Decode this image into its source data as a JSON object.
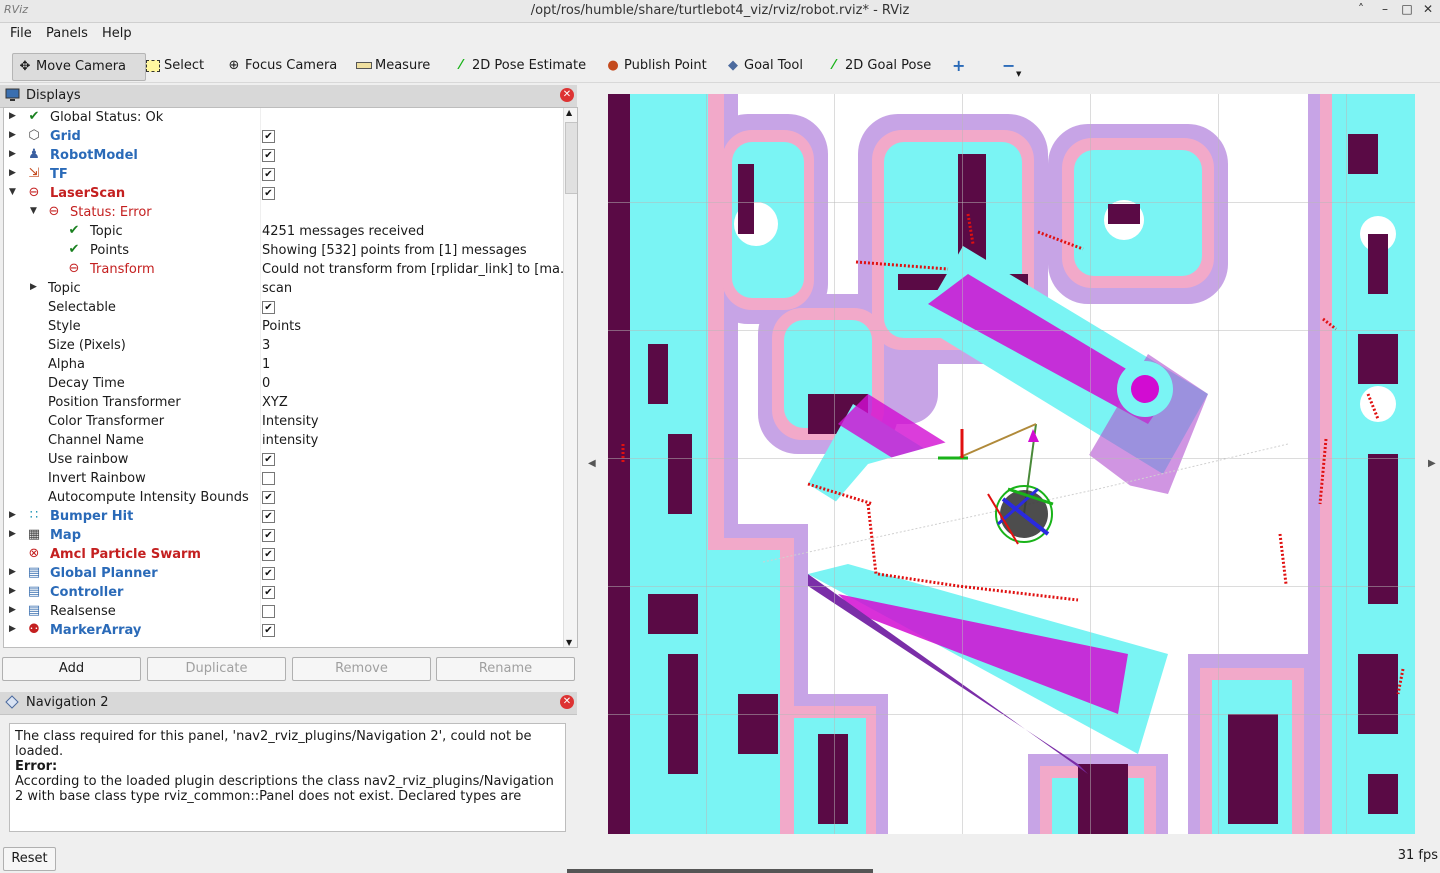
{
  "window": {
    "title": "/opt/ros/humble/share/turtlebot4_viz/rviz/robot.rviz* - RViz",
    "app_icon": "RViz",
    "buttons": [
      "˄",
      "–",
      "□",
      "✕"
    ]
  },
  "menu": {
    "file": "File",
    "panels": "Panels",
    "help": "Help"
  },
  "toolbar": {
    "move_camera": "Move Camera",
    "select": "Select",
    "focus_camera": "Focus Camera",
    "measure": "Measure",
    "pose_estimate": "2D Pose Estimate",
    "publish_point": "Publish Point",
    "goal_tool": "Goal Tool",
    "goal_pose": "2D Goal Pose",
    "add_icon": "+",
    "remove_icon": "−"
  },
  "displays": {
    "title": "Displays",
    "rows": [
      {
        "name": "Global Status: Ok"
      },
      {
        "name": "Grid"
      },
      {
        "name": "RobotModel"
      },
      {
        "name": "TF"
      },
      {
        "name": "LaserScan"
      },
      {
        "name": "Status: Error"
      },
      {
        "name": "Topic",
        "value": "4251 messages received"
      },
      {
        "name": "Points",
        "value": "Showing [532] points from [1] messages"
      },
      {
        "name": "Transform",
        "value": "Could not transform from [rplidar_link] to [ma..."
      },
      {
        "name": "Topic",
        "value": "scan"
      },
      {
        "name": "Selectable"
      },
      {
        "name": "Style",
        "value": "Points"
      },
      {
        "name": "Size (Pixels)",
        "value": "3"
      },
      {
        "name": "Alpha",
        "value": "1"
      },
      {
        "name": "Decay Time",
        "value": "0"
      },
      {
        "name": "Position Transformer",
        "value": "XYZ"
      },
      {
        "name": "Color Transformer",
        "value": "Intensity"
      },
      {
        "name": "Channel Name",
        "value": "intensity"
      },
      {
        "name": "Use rainbow"
      },
      {
        "name": "Invert Rainbow"
      },
      {
        "name": "Autocompute Intensity Bounds"
      },
      {
        "name": "Bumper Hit"
      },
      {
        "name": "Map"
      },
      {
        "name": "Amcl Particle Swarm"
      },
      {
        "name": "Global Planner"
      },
      {
        "name": "Controller"
      },
      {
        "name": "Realsense"
      },
      {
        "name": "MarkerArray"
      }
    ],
    "buttons": {
      "add": "Add",
      "duplicate": "Duplicate",
      "remove": "Remove",
      "rename": "Rename"
    }
  },
  "navigation": {
    "title": "Navigation 2",
    "line1": "The class required for this panel, 'nav2_rviz_plugins/Navigation 2', could not be loaded.",
    "error_label": "Error:",
    "line2": "According to the loaded plugin descriptions the class nav2_rviz_plugins/Navigation 2 with base class type rviz_common::Panel does not exist. Declared types are"
  },
  "footer": {
    "reset": "Reset",
    "fps": "31 fps"
  },
  "colors": {
    "occupied": "#5a0a45",
    "inflation_cyan": "#7af4f4",
    "inflation_pink": "#f2a9c9",
    "inflation_lavender": "#c7a4e6",
    "costmap_magenta": "#d20cd2",
    "laser_red": "#e01010",
    "error_red": "#c42020",
    "link_blue": "#2a6ab8"
  }
}
